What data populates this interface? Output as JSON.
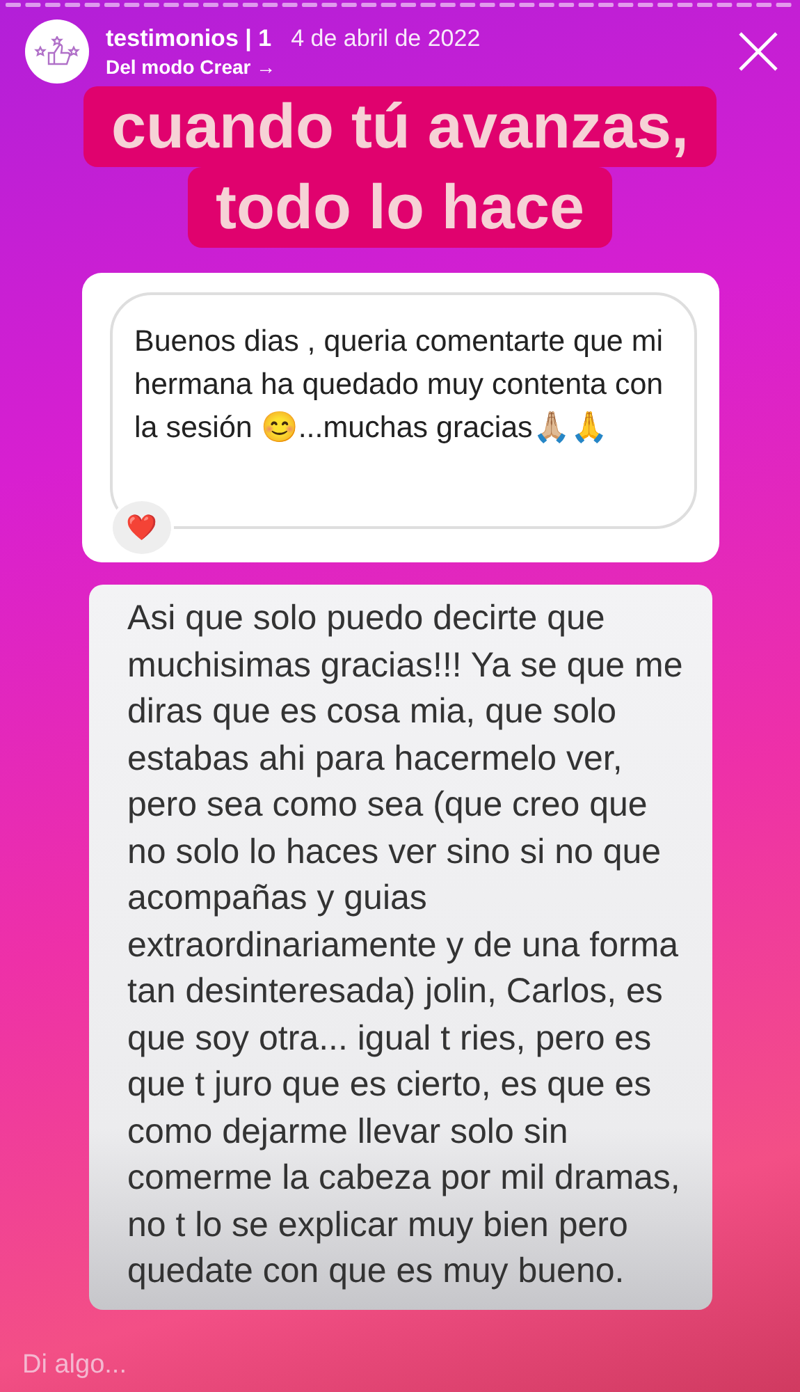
{
  "header": {
    "account": "testimonios | 1",
    "date": "4 de abril de 2022",
    "subtitle": "Del modo Crear",
    "subtitle_arrow": "→"
  },
  "headline": [
    "cuando tú avanzas,",
    "todo lo hace"
  ],
  "message": {
    "text": "Buenos dias , queria comentarte que mi hermana ha quedado muy contenta con la sesión 😊...muchas gracias🙏🏼🙏",
    "reaction": "❤️"
  },
  "long_message": "Asi que solo puedo decirte que muchisimas gracias!!! Ya se que me diras que es cosa mia, que solo estabas ahi para hacermelo ver, pero sea como sea (que creo que no solo lo haces ver sino si no que acompañas y guias extraordinariamente y de una forma tan desinteresada) jolin, Carlos, es que soy otra... igual t ries, pero es que t juro que es cierto, es que es como dejarme llevar solo sin comerme la cabeza por mil dramas, no t lo se explicar muy bien pero quedate con que es muy bueno.",
  "reply": {
    "placeholder": "Di algo..."
  }
}
